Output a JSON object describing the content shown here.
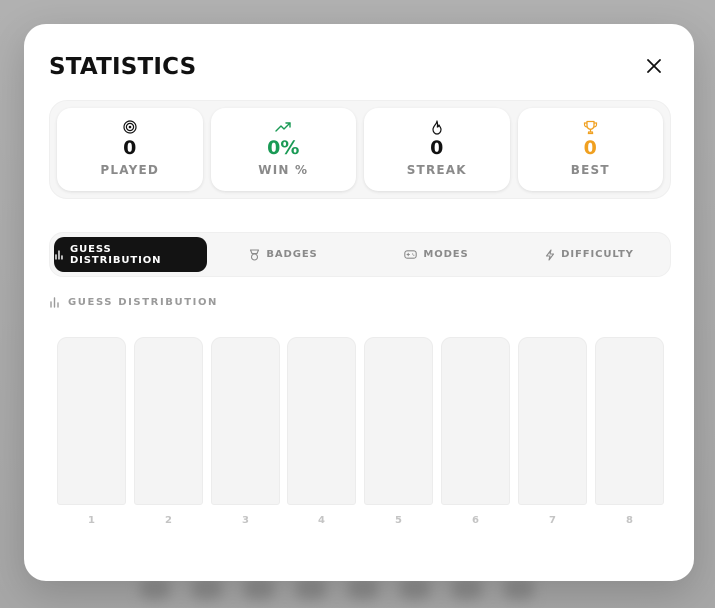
{
  "modal": {
    "title": "STATISTICS"
  },
  "stats": [
    {
      "icon": "target-icon",
      "value": "0",
      "label": "PLAYED",
      "color": "#111111"
    },
    {
      "icon": "trending-up-icon",
      "value": "0%",
      "label": "WIN %",
      "color": "#1a9a55"
    },
    {
      "icon": "flame-icon",
      "value": "0",
      "label": "STREAK",
      "color": "#111111"
    },
    {
      "icon": "trophy-icon",
      "value": "0",
      "label": "BEST",
      "color": "#f0a020"
    }
  ],
  "tabs": [
    {
      "icon": "bar-chart-icon",
      "label": "GUESS DISTRIBUTION",
      "active": true
    },
    {
      "icon": "badge-icon",
      "label": "BADGES",
      "active": false
    },
    {
      "icon": "gamepad-icon",
      "label": "MODES",
      "active": false
    },
    {
      "icon": "bolt-icon",
      "label": "DIFFICULTY",
      "active": false
    }
  ],
  "section": {
    "heading": "GUESS DISTRIBUTION"
  },
  "distribution": {
    "guesses": [
      "1",
      "2",
      "3",
      "4",
      "5",
      "6",
      "7",
      "8"
    ],
    "counts": [
      0,
      0,
      0,
      0,
      0,
      0,
      0,
      0
    ]
  }
}
